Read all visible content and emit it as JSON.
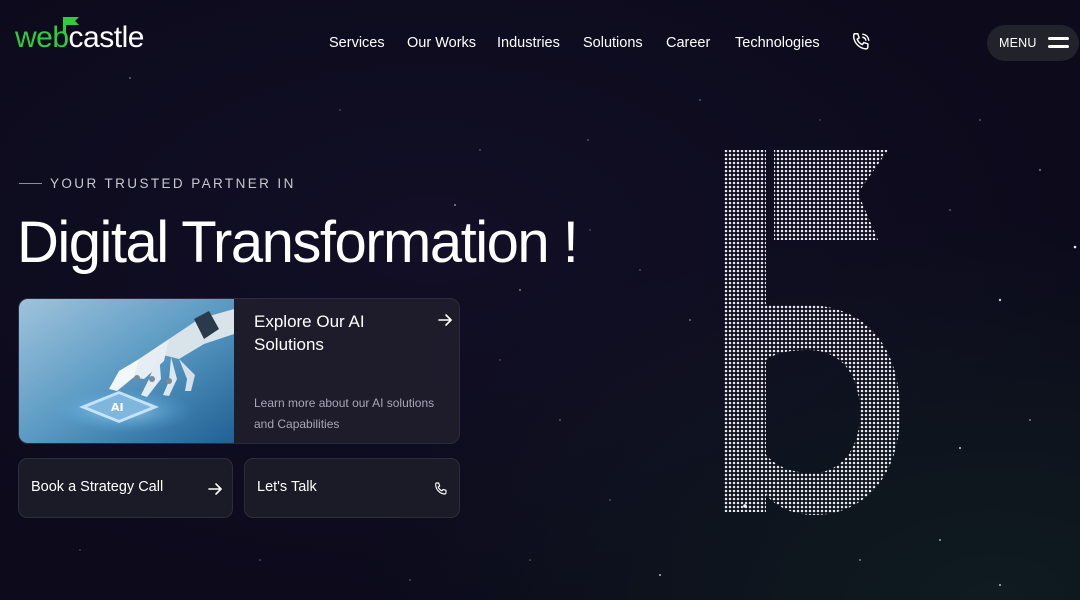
{
  "brand": {
    "logo_web": "web",
    "logo_castle": "castle",
    "accent_color": "#2ecc40"
  },
  "nav": {
    "items": [
      {
        "label": "Services"
      },
      {
        "label": "Our Works"
      },
      {
        "label": "Industries"
      },
      {
        "label": "Solutions"
      },
      {
        "label": "Career"
      },
      {
        "label": "Technologies"
      }
    ],
    "phone_icon": "phone-icon",
    "menu_label": "MENU",
    "menu_icon": "hamburger-icon"
  },
  "hero": {
    "eyebrow": "YOUR TRUSTED PARTNER IN",
    "title": "Digital Transformation !"
  },
  "ai_card": {
    "title": "Explore Our AI Solutions",
    "description": "Learn more about our AI solutions and Capabilities",
    "image_icon": "robot-hand-ai-chip-image",
    "arrow_icon": "arrow-right-icon"
  },
  "actions": {
    "strategy_label": "Book a Strategy Call",
    "strategy_icon": "arrow-right-icon",
    "talk_label": "Let's Talk",
    "talk_icon": "phone-icon"
  },
  "colors": {
    "background": "#0c0a1b",
    "card": "#1e1c2b",
    "text_muted": "#a9a7b6"
  }
}
